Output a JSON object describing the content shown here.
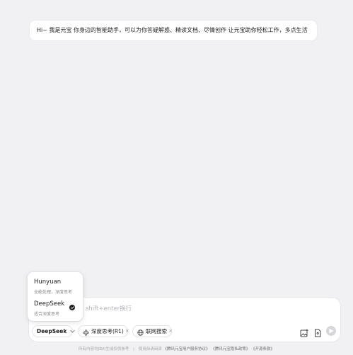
{
  "welcome": {
    "text": "Hi~ 我是元宝 你身边的智能助手，可以为你答疑解惑、精读文档、尽情创作 让元宝助你轻松工作，多点生活"
  },
  "input": {
    "placeholder": "shift+enter换行"
  },
  "toolbar": {
    "model_label": "DeepSeek",
    "think_label": "深度思考(R1)",
    "think_close": "×",
    "web_label": "联网搜索",
    "web_close": "×"
  },
  "model_menu": {
    "options": [
      {
        "name": "Hunyuan",
        "desc": "全能处理，深度思考"
      },
      {
        "name": "DeepSeek",
        "desc": "适合深度思考",
        "selected": true
      }
    ]
  },
  "footer": {
    "notice": "所有内容均由AI生成仅供参考",
    "policy_prefix": "使用前请阅读",
    "link_terms": "《腾讯元宝用户服务协议》",
    "link_privacy": "《腾讯元宝隐私政策》",
    "link_oss": "《开源条款》"
  },
  "icons": {
    "model_chevron": "chevron-down-icon",
    "think": "atom-icon",
    "web": "globe-icon",
    "image_upload": "image-upload-icon",
    "file_upload": "file-upload-icon",
    "send": "send-icon",
    "check": "check-icon"
  },
  "colors": {
    "background": "#f1f1f3",
    "card": "#ffffff",
    "send_disabled": "#d7d7db"
  }
}
